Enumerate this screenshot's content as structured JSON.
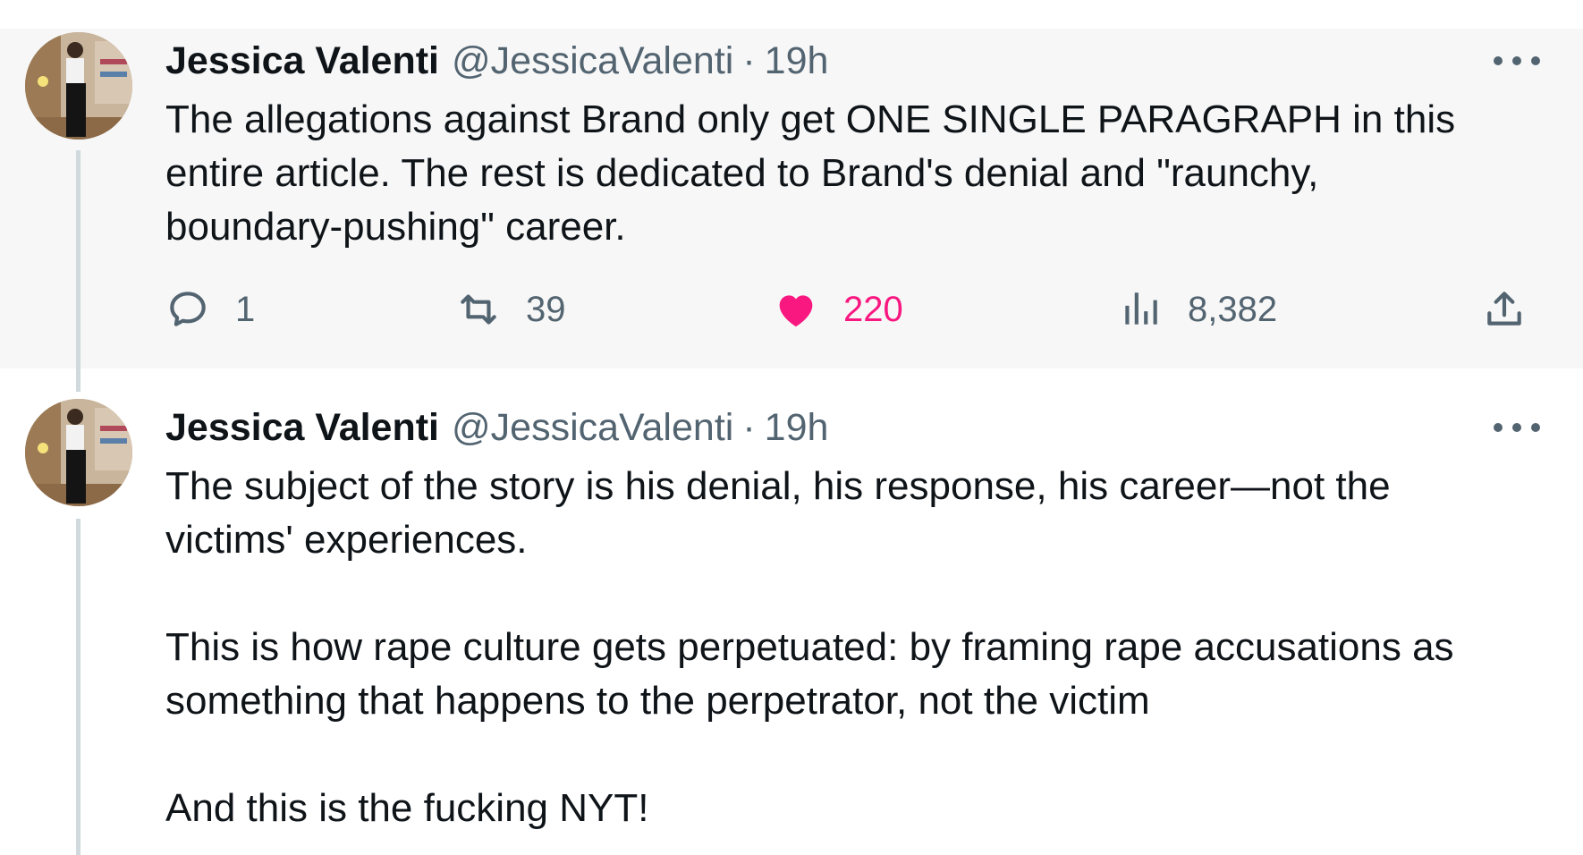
{
  "tweets": [
    {
      "author_name": "Jessica Valenti",
      "handle": "@JessicaValenti",
      "separator": "·",
      "time": "19h",
      "body": [
        "The allegations against Brand only get ONE SINGLE PARAGRAPH in this",
        "entire article. The rest is dedicated to Brand's denial and \"raunchy,",
        "boundary-pushing\" career."
      ],
      "stats": {
        "replies": "1",
        "retweets": "39",
        "likes": "220",
        "views": "8,382"
      },
      "liked": true
    },
    {
      "author_name": "Jessica Valenti",
      "handle": "@JessicaValenti",
      "separator": "·",
      "time": "19h",
      "body": [
        "The subject of the story is his denial, his response, his career—not the",
        "victims' experiences.",
        "",
        "This is how rape culture gets perpetuated: by framing rape accusations as",
        "something that happens to the perpetrator, not the victim",
        "",
        "And this is the fucking NYT!"
      ]
    }
  ],
  "icons": {
    "reply": "comment-bubble-icon",
    "retweet": "retweet-arrows-icon",
    "like": "heart-icon",
    "views": "bar-chart-icon",
    "share": "share-upload-icon",
    "more": "ellipsis-icon"
  },
  "colors": {
    "text_primary": "#0f1419",
    "text_secondary": "#536471",
    "like_active": "#f91880",
    "highlight_background": "#f7f7f7",
    "thread_line": "#cfd9de"
  }
}
